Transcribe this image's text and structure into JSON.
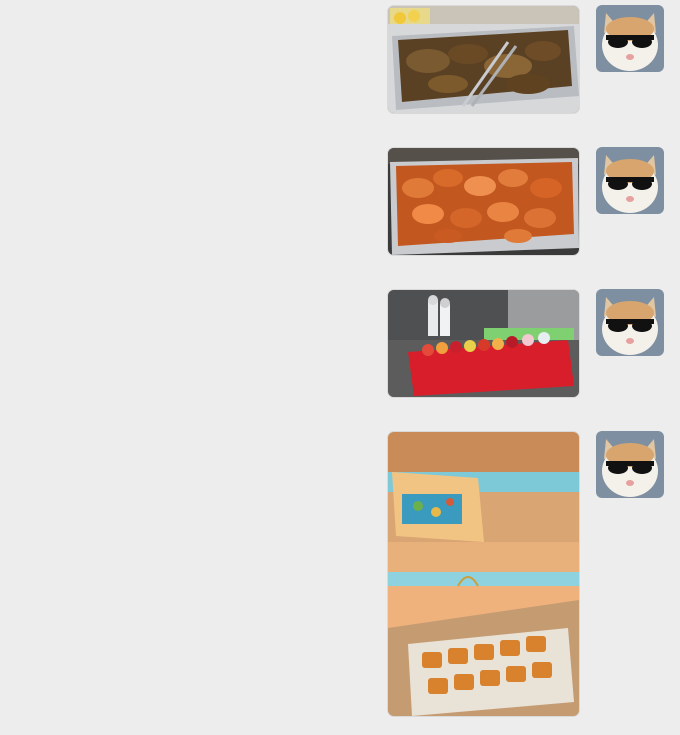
{
  "messages": [
    {
      "image": "braised-meat-tray",
      "avatar": "cat-sunglasses-icon"
    },
    {
      "image": "shrimp-tray",
      "avatar": "cat-sunglasses-icon"
    },
    {
      "image": "fruit-stand",
      "avatar": "cat-sunglasses-icon"
    },
    {
      "image": "gift-boxes",
      "avatar": "cat-sunglasses-icon"
    }
  ]
}
